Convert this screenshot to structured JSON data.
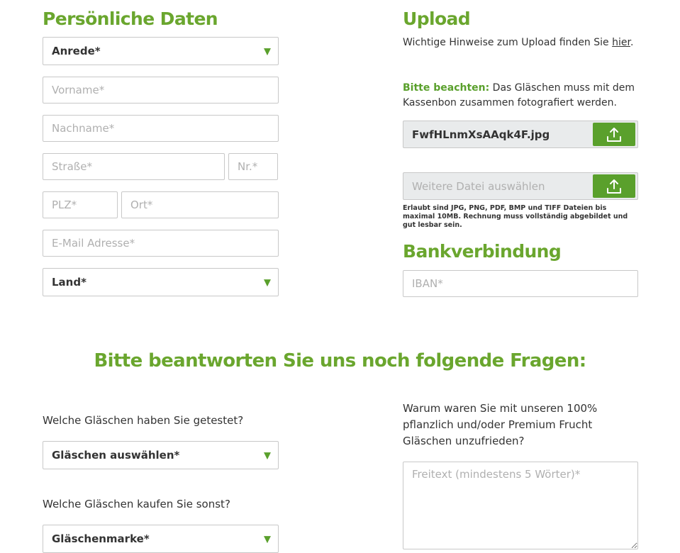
{
  "personal": {
    "title": "Persönliche Daten",
    "salutation": "Anrede*",
    "firstname_ph": "Vorname*",
    "lastname_ph": "Nachname*",
    "street_ph": "Straße*",
    "number_ph": "Nr.*",
    "zip_ph": "PLZ*",
    "city_ph": "Ort*",
    "email_ph": "E-Mail Adresse*",
    "country": "Land*"
  },
  "upload": {
    "title": "Upload",
    "hint_prefix": "Wichtige Hinweise zum Upload finden Sie ",
    "hint_link": "hier",
    "hint_suffix": ".",
    "notice_label": "Bitte beachten:",
    "notice_text": " Das Gläschen muss mit dem Kassenbon zusammen fotografiert werden.",
    "file_name": "FwfHLnmXsAAqk4F.jpg",
    "more_file_ph": "Weitere Datei auswählen",
    "allowed": "Erlaubt sind JPG, PNG, PDF, BMP und TIFF Dateien bis maximal 10MB. Rechnung muss vollständig abgebildet und gut lesbar sein."
  },
  "bank": {
    "title": "Bankverbindung",
    "iban_ph": "IBAN*"
  },
  "questions": {
    "title": "Bitte beantworten Sie uns noch folgende Fragen:",
    "q1": "Welche Gläschen haben Sie getestet?",
    "q1_select": "Gläschen auswählen*",
    "q2": "Welche Gläschen kaufen Sie sonst?",
    "q2_select": "Gläschenmarke*",
    "q3": "Warum waren Sie mit unseren 100% pflanzlich und/oder Premium Frucht Gläschen unzufrieden?",
    "q3_ph": "Freitext (mindestens 5 Wörter)*"
  },
  "icons": {
    "caret": "▼"
  },
  "colors": {
    "accent": "#6aa62e",
    "button": "#5aa02c"
  }
}
